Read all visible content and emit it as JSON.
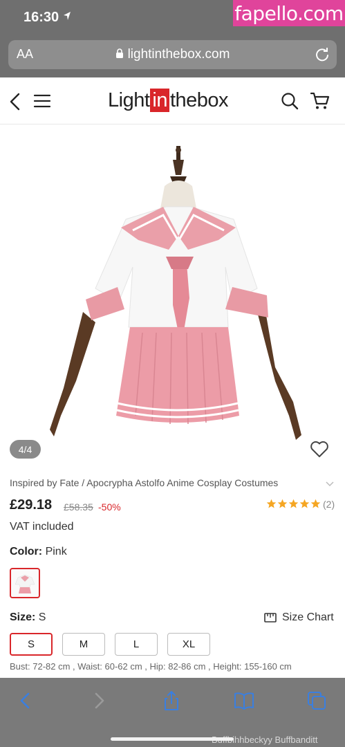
{
  "status_bar": {
    "time": "16:30"
  },
  "watermark": {
    "top": "fapello.com",
    "bottom": "Buffbihhbeckyy Buffbanditt"
  },
  "browser": {
    "aa_label": "AA",
    "url": "lightinthebox.com"
  },
  "site": {
    "logo_before": "Light",
    "logo_in": "in",
    "logo_after": "thebox",
    "brand_color": "#d9262a"
  },
  "product": {
    "image_counter": "4/4",
    "title": "Inspired by Fate / Apocrypha Astolfo Anime Cosplay Costumes",
    "price": "£29.18",
    "old_price": "£58.35",
    "discount": "-50%",
    "rating_stars": 5,
    "review_count": "(2)",
    "vat": "VAT included",
    "color_label": "Color:",
    "color_value": "Pink",
    "size_label": "Size:",
    "size_value": "S",
    "size_chart_label": "Size Chart",
    "sizes": [
      "S",
      "M",
      "L",
      "XL"
    ],
    "selected_size": "S",
    "measurements": "Bust: 72-82 cm , Waist: 60-62 cm , Hip: 82-86 cm , Height: 155-160 cm"
  },
  "toolbar": {
    "icons": [
      "back-icon",
      "forward-icon",
      "share-icon",
      "bookmarks-icon",
      "tabs-icon"
    ]
  }
}
